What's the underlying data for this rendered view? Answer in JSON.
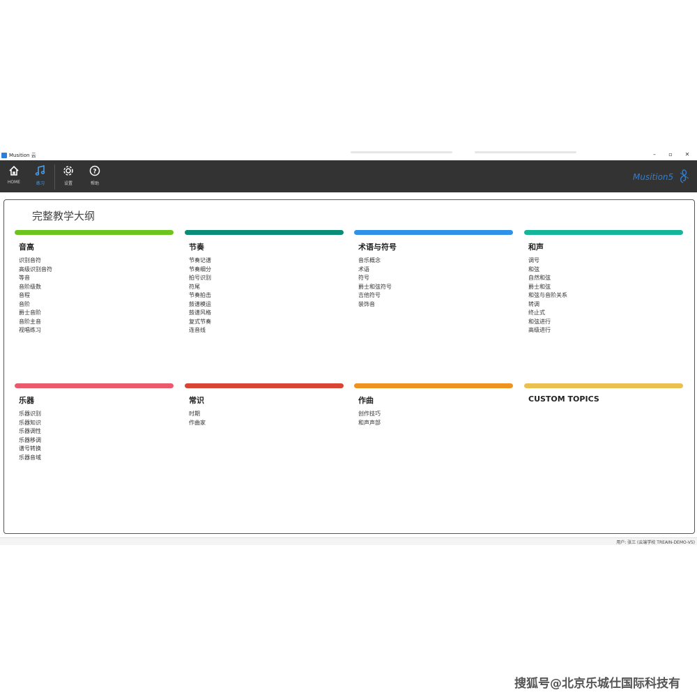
{
  "window": {
    "title": "Musition 云",
    "controls": [
      "–",
      "▫",
      "✕"
    ]
  },
  "toolbar": {
    "items": [
      {
        "label": "HOME",
        "icon": "home-icon"
      },
      {
        "label": "练习",
        "icon": "music-note-icon",
        "active": true
      },
      {
        "label": "设置",
        "icon": "gear-icon"
      },
      {
        "label": "帮助",
        "icon": "help-icon"
      }
    ],
    "brand": "Musition5"
  },
  "main": {
    "title": "完整教学大纲",
    "categories": [
      {
        "title": "音高",
        "color": "#6cc51f",
        "items": [
          "识别音符",
          "高级识别音符",
          "等音",
          "音阶级数",
          "音程",
          "音阶",
          "爵士音阶",
          "音阶主音",
          "视唱练习"
        ]
      },
      {
        "title": "节奏",
        "color": "#0a8d78",
        "items": [
          "节奏记谱",
          "节奏细分",
          "拍号识别",
          "符尾",
          "节奏拍击",
          "鼓谱模运",
          "鼓谱风格",
          "复式节奏",
          "连音线"
        ]
      },
      {
        "title": "术语与符号",
        "color": "#2f91e8",
        "items": [
          "音乐概念",
          "术语",
          "符号",
          "爵士和弦符号",
          "吉他符号",
          "装饰音"
        ]
      },
      {
        "title": "和声",
        "color": "#14b59a",
        "items": [
          "调号",
          "和弦",
          "自然和弦",
          "爵士和弦",
          "和弦与音阶关系",
          "转调",
          "终止式",
          "和弦进行",
          "高级进行"
        ]
      },
      {
        "title": "乐器",
        "color": "#eb5a6c",
        "items": [
          "乐器识别",
          "乐器知识",
          "乐器调性",
          "乐器移调",
          "谱号转换",
          "乐器音域"
        ]
      },
      {
        "title": "常识",
        "color": "#d94534",
        "items": [
          "时期",
          "作曲家"
        ]
      },
      {
        "title": "作曲",
        "color": "#ef9320",
        "items": [
          "创作技巧",
          "和声声部"
        ]
      },
      {
        "title": "CUSTOM TOPICS",
        "color": "#ecc050",
        "items": []
      }
    ]
  },
  "status": {
    "text": "用户: 张三 (云端学校 TREAIN-DEMO-V5)"
  },
  "watermark": "搜狐号@北京乐城仕国际科技有"
}
